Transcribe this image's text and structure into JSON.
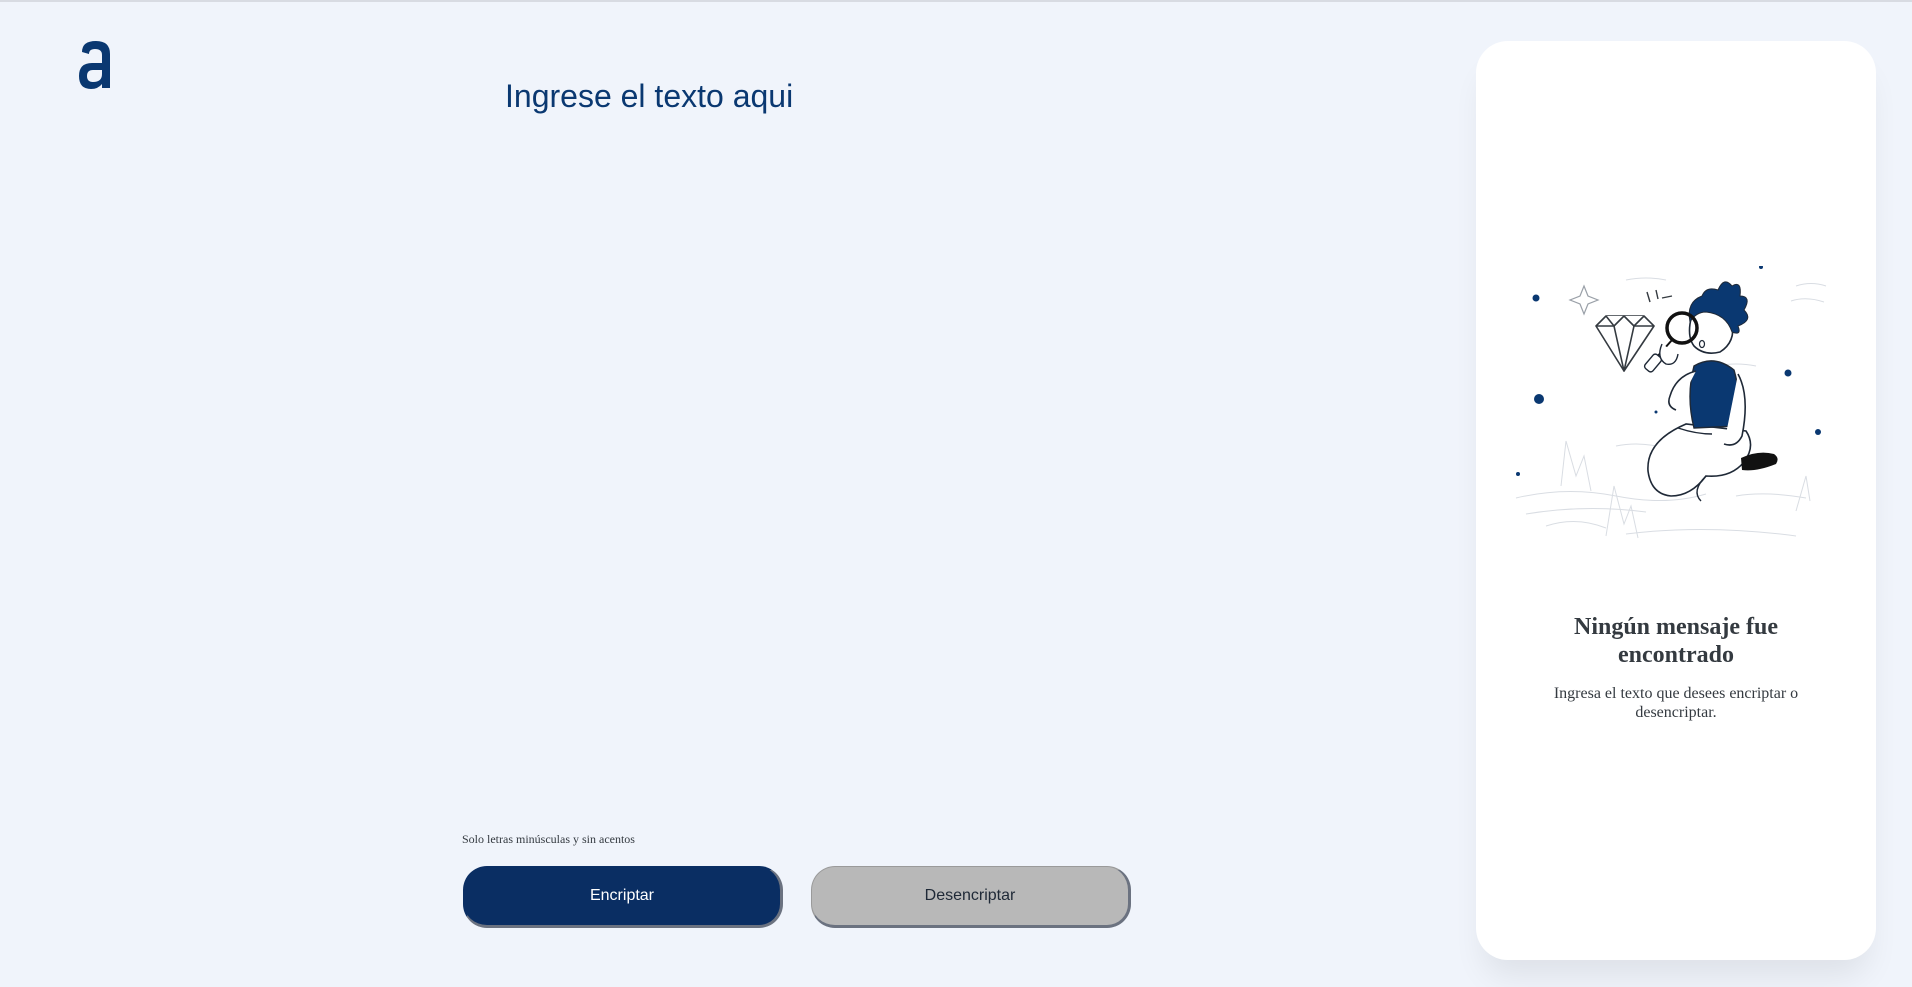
{
  "main": {
    "textarea_placeholder": "Ingrese el texto aqui",
    "hint_text": "Solo letras minúsculas y sin acentos"
  },
  "buttons": {
    "encrypt_label": "Encriptar",
    "decrypt_label": "Desencriptar"
  },
  "output": {
    "title": "Ningún mensaje fue encontrado",
    "text": "Ingresa el texto que desees encriptar o desencriptar."
  },
  "icons": {
    "logo": "alura-logo-icon",
    "illustration": "boy-magnifying-glass-illustration"
  },
  "colors": {
    "background": "#F0F4FB",
    "primary": "#0A3871",
    "button_primary": "#0A2E63",
    "button_secondary": "#B8B8B8",
    "text_dark": "#343A40"
  }
}
